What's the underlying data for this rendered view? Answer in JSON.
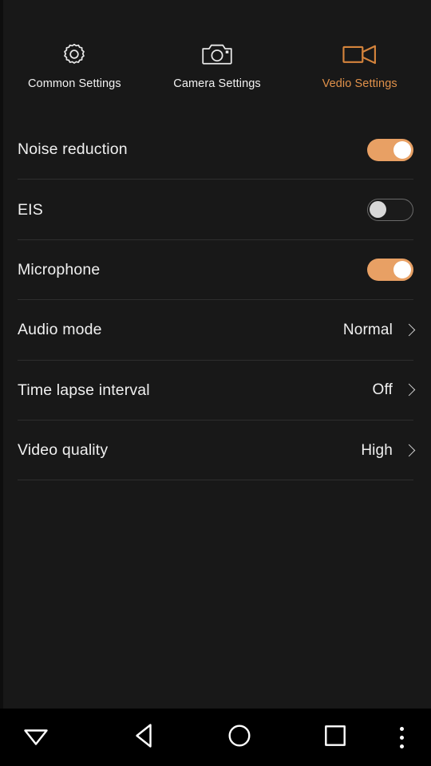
{
  "theme": {
    "background": "#181818",
    "navbar_background": "#000000",
    "accent": "#e0914a",
    "toggle_on": "#e8a064",
    "text": "#f0f0f0",
    "divider": "#2e2e2e"
  },
  "tabs": [
    {
      "label": "Common Settings",
      "icon": "gear-icon",
      "active": false
    },
    {
      "label": "Camera Settings",
      "icon": "camera-icon",
      "active": false
    },
    {
      "label": "Vedio Settings",
      "icon": "video-camera-icon",
      "active": true
    }
  ],
  "settings_rows": [
    {
      "label": "Noise reduction",
      "type": "toggle",
      "value": "on"
    },
    {
      "label": "EIS",
      "type": "toggle",
      "value": "off"
    },
    {
      "label": "Microphone",
      "type": "toggle",
      "value": "on"
    },
    {
      "label": "Audio mode",
      "type": "value",
      "value": "Normal"
    },
    {
      "label": "Time lapse interval",
      "type": "value",
      "value": "Off"
    },
    {
      "label": "Video quality",
      "type": "value",
      "value": "High"
    }
  ],
  "navbar": [
    {
      "name": "hide-keyboard-button",
      "icon": "triangle-down-icon"
    },
    {
      "name": "back-button",
      "icon": "triangle-left-icon"
    },
    {
      "name": "home-button",
      "icon": "circle-icon"
    },
    {
      "name": "recents-button",
      "icon": "square-icon"
    },
    {
      "name": "overflow-menu-button",
      "icon": "three-dots-vertical-icon"
    }
  ]
}
